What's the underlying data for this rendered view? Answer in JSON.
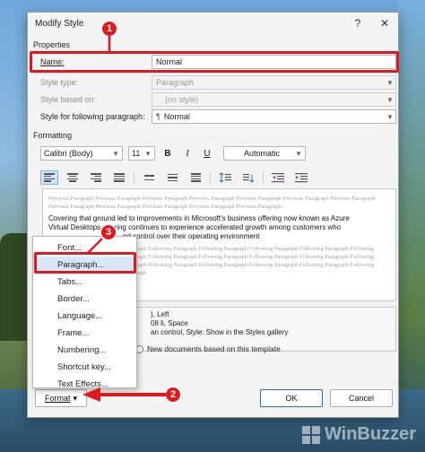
{
  "dialog": {
    "title": "Modify Style",
    "help_label": "?",
    "close_label": "✕"
  },
  "properties": {
    "section_label": "Properties",
    "name_label": "Name:",
    "name_value": "Normal",
    "style_type_label": "Style type:",
    "style_type_value": "Paragraph",
    "based_on_label": "Style based on:",
    "based_on_value": "(no style)",
    "following_label": "Style for following paragraph:",
    "following_value": "Normal",
    "following_icon_glyph": "¶"
  },
  "formatting": {
    "section_label": "Formatting",
    "font": "Calibri (Body)",
    "size": "11",
    "bold": "B",
    "italic": "I",
    "underline": "U",
    "color": "Automatic"
  },
  "preview": {
    "previous": "Previous Paragraph Previous Paragraph Previous Paragraph Previous Paragraph Previous Paragraph Previous Paragraph Previous Paragraph Previous Paragraph Previous Paragraph Previous Paragraph Previous Paragraph Previous Paragraph",
    "main_line1": "Covering that ground led to improvements in Microsoft's business offering now known as Azure",
    "main_line2": "Virtual Desktop",
    "main_line2b": "s offering continues to experience accelerated growth among customers who",
    "main_line3b": "nd control over their operating environment",
    "following": "Paragraph Following Paragraph Following Paragraph Following Paragraph Following Paragraph Following Paragraph Following Paragraph Following Paragraph Following Paragraph Following Paragraph Following Paragraph Following Paragraph Following Paragraph Following Paragraph Following Paragraph Following Paragraph"
  },
  "description": {
    "line1": "), Left",
    "line2": "08 li, Space",
    "line3": "an control, Style: Show in the Styles gallery"
  },
  "options": {
    "new_docs_label": "New documents based on this template"
  },
  "format_menu": {
    "items": [
      "Font...",
      "Paragraph...",
      "Tabs...",
      "Border...",
      "Language...",
      "Frame...",
      "Numbering...",
      "Shortcut key...",
      "Text Effects..."
    ]
  },
  "buttons": {
    "format": "Format",
    "format_chevron": "▾",
    "ok": "OK",
    "cancel": "Cancel"
  },
  "callouts": {
    "one": "1",
    "two": "2",
    "three": "3"
  },
  "watermark": {
    "text": "WinBuzzer"
  },
  "colors": {
    "annotation_red": "#e0191e",
    "hover_blue": "#d8e6f5",
    "primary_border": "#2a6cc7"
  }
}
